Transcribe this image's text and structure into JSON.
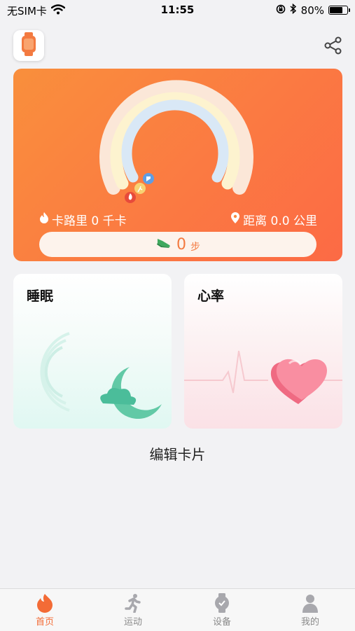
{
  "status_bar": {
    "carrier": "无SIM卡",
    "time": "11:55",
    "battery_percent": "80%",
    "battery_level": 0.8
  },
  "header": {
    "left_icon": "watch-icon",
    "right_icon": "share-icon"
  },
  "activity": {
    "calories_text": "卡路里 0 千卡",
    "distance_text": "距离 0.0 公里",
    "steps_value": "0",
    "steps_unit": "步",
    "ring_icons": [
      "flame-icon",
      "runner-icon",
      "shoe-icon"
    ],
    "colors": {
      "card_start": "#f98f3c",
      "card_end": "#fc6a45",
      "accent": "#f37a40"
    }
  },
  "cards": [
    {
      "title": "睡眠",
      "icon": "moon-cloud-icon"
    },
    {
      "title": "心率",
      "icon": "heart-icon"
    }
  ],
  "edit_cards_label": "编辑卡片",
  "tab_bar": {
    "items": [
      {
        "label": "首页",
        "icon": "flame-icon",
        "active": true
      },
      {
        "label": "运动",
        "icon": "runner-icon",
        "active": false
      },
      {
        "label": "设备",
        "icon": "watch-icon",
        "active": false
      },
      {
        "label": "我的",
        "icon": "person-icon",
        "active": false
      }
    ],
    "active_color": "#f36b36"
  }
}
